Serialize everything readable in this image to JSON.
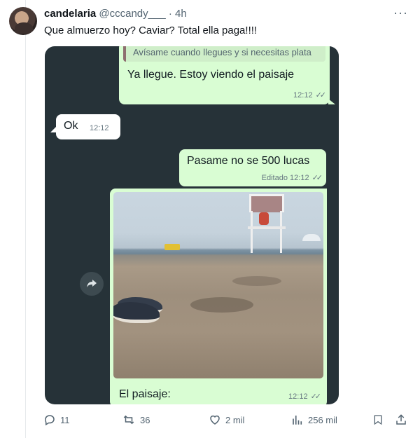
{
  "tweet": {
    "author_name": "candelaria",
    "handle": "@cccandy___",
    "separator": "·",
    "time": "4h",
    "more": "···",
    "text": "Que almuerzo hoy? Caviar? Total ella paga!!!!"
  },
  "chat": {
    "messages": [
      {
        "quoted": "Avísame cuando llegues y si necesitas plata",
        "text": "Ya llegue. Estoy viendo el paisaje",
        "time": "12:12",
        "status": "read"
      },
      {
        "text": "Ok",
        "time": "12:12",
        "incoming": true
      },
      {
        "text": "Pasame no se 500 lucas",
        "edited_label": "Editado",
        "time": "12:12",
        "status": "read"
      },
      {
        "caption": "El paisaje:",
        "time": "12:12",
        "status": "read",
        "has_photo": true
      }
    ],
    "colors": {
      "background": "#263238",
      "outgoing": "#d9fdd3",
      "incoming": "#ffffff"
    }
  },
  "actions": {
    "replies": "11",
    "reposts": "36",
    "likes": "2 mil",
    "views": "256 mil"
  },
  "icons": [
    "reply-icon",
    "repost-icon",
    "like-icon",
    "views-icon",
    "bookmark-icon",
    "share-icon",
    "forward-icon"
  ]
}
